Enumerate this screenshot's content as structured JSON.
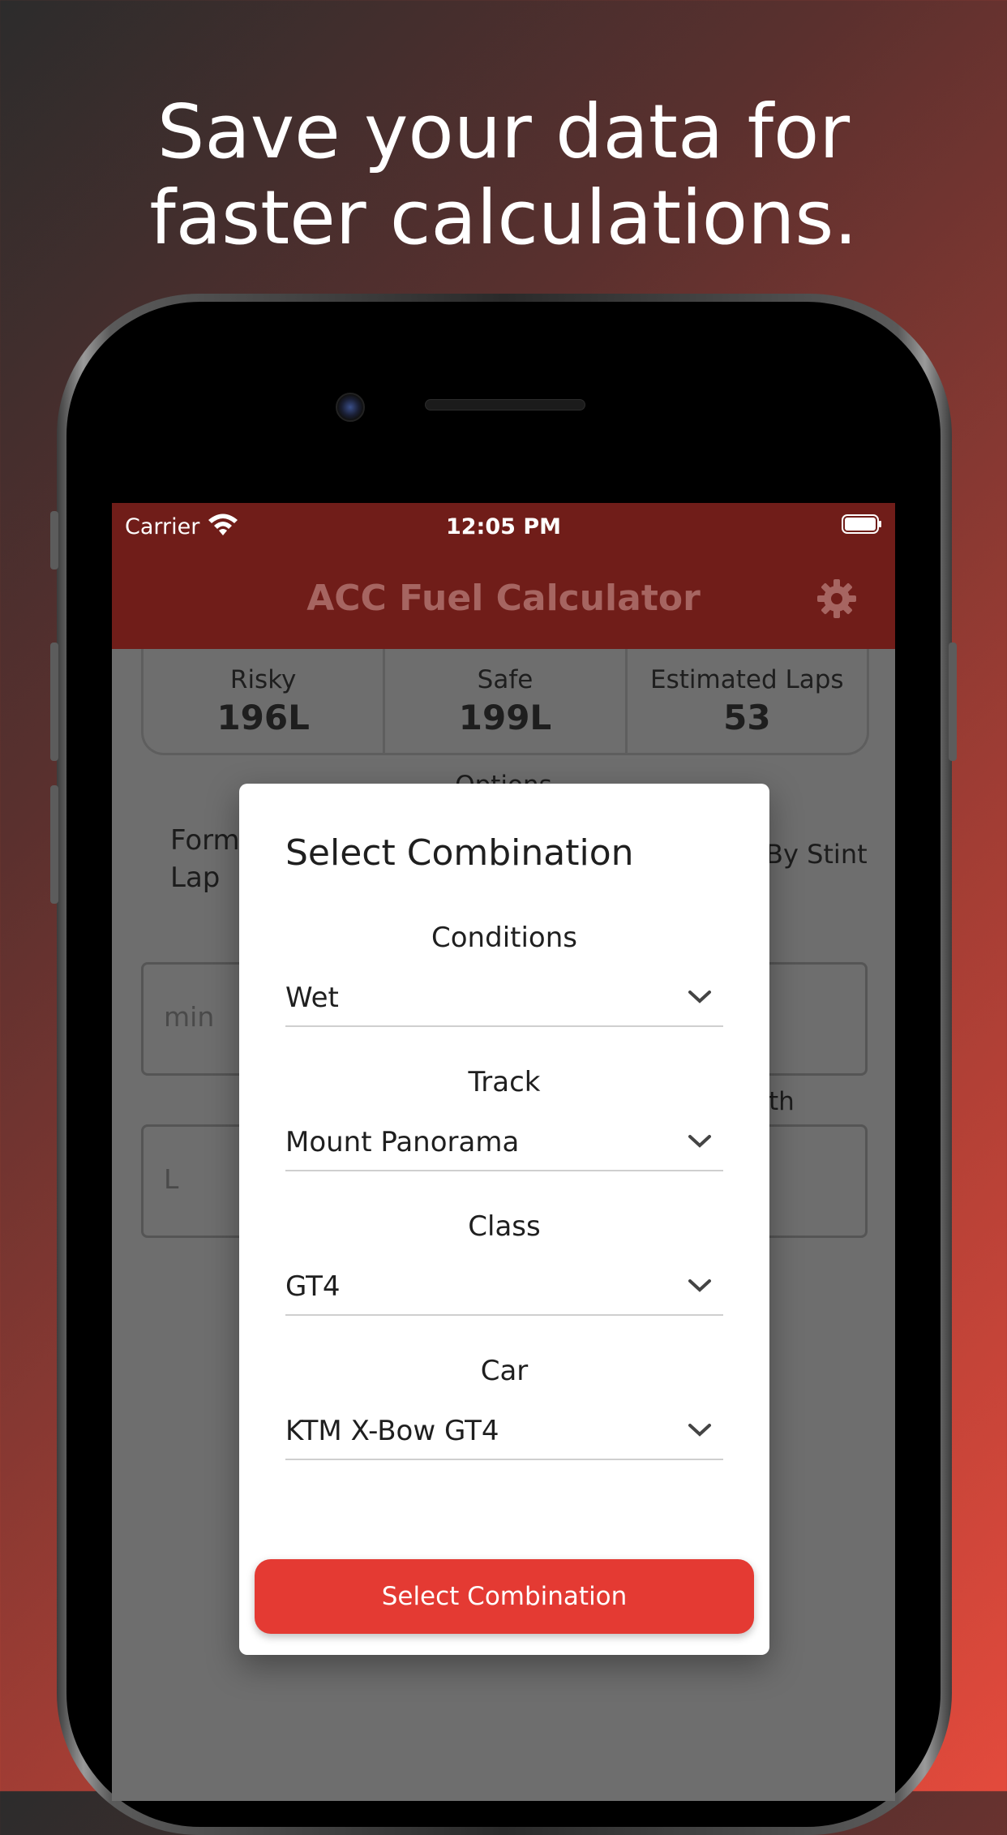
{
  "promo": {
    "headline_line1": "Save your data for",
    "headline_line2": "faster calculations."
  },
  "status_bar": {
    "carrier": "Carrier",
    "time": "12:05 PM"
  },
  "header": {
    "title": "ACC Fuel Calculator",
    "settings_icon": "gear-icon"
  },
  "results": [
    {
      "label": "Risky",
      "value": "196L"
    },
    {
      "label": "Safe",
      "value": "199L"
    },
    {
      "label": "Estimated Laps",
      "value": "53"
    }
  ],
  "background": {
    "options_label": "Options",
    "formation_lap_1": "Form",
    "formation_lap_2": "Lap",
    "by_stint": "By Stint",
    "min_placeholder": "min",
    "liters_placeholder": "L",
    "length_fragment": "th"
  },
  "modal": {
    "title": "Select Combination",
    "fields": [
      {
        "label": "Conditions",
        "value": "Wet"
      },
      {
        "label": "Track",
        "value": "Mount Panorama"
      },
      {
        "label": "Class",
        "value": "GT4"
      },
      {
        "label": "Car",
        "value": "KTM X-Bow GT4"
      }
    ],
    "confirm_button": "Select Combination"
  },
  "colors": {
    "header_bg": "#701d19",
    "accent": "#e43a33"
  }
}
